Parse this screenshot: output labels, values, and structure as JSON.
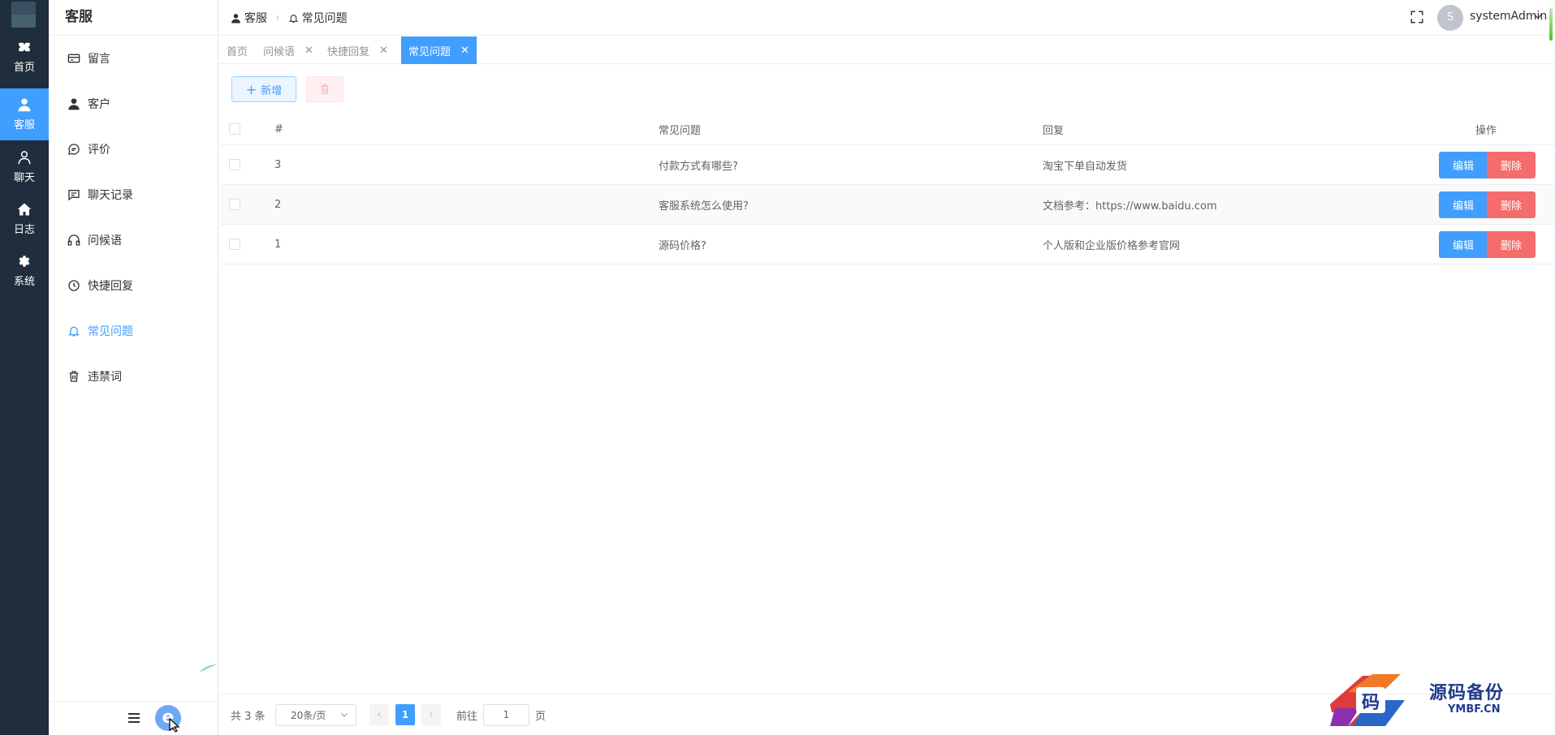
{
  "rail": {
    "items": [
      {
        "label": "首页",
        "icon": "home-ticket-icon"
      },
      {
        "label": "客服",
        "icon": "person-icon",
        "active": true
      },
      {
        "label": "聊天",
        "icon": "user-outline-icon"
      },
      {
        "label": "日志",
        "icon": "house-icon"
      },
      {
        "label": "系统",
        "icon": "gear-icon"
      }
    ]
  },
  "sidebar": {
    "title": "客服",
    "items": [
      {
        "label": "留言",
        "icon": "card-icon"
      },
      {
        "label": "客户",
        "icon": "person-icon"
      },
      {
        "label": "评价",
        "icon": "chat-circle-icon"
      },
      {
        "label": "聊天记录",
        "icon": "message-icon"
      },
      {
        "label": "问候语",
        "icon": "headset-icon"
      },
      {
        "label": "快捷回复",
        "icon": "clock-icon"
      },
      {
        "label": "常见问题",
        "icon": "bell-icon",
        "active": true
      },
      {
        "label": "违禁词",
        "icon": "trash-icon"
      }
    ],
    "footer_logo": "e"
  },
  "topbar": {
    "breadcrumb": [
      "客服",
      "常见问题"
    ],
    "avatar_letter": "S",
    "username": "systemAdmin"
  },
  "tags": [
    {
      "label": "首页",
      "closable": false
    },
    {
      "label": "问候语",
      "closable": true
    },
    {
      "label": "快捷回复",
      "closable": true
    },
    {
      "label": "常见问题",
      "closable": true,
      "active": true
    }
  ],
  "toolbar": {
    "add_label": "新增"
  },
  "table": {
    "headers": {
      "num": "#",
      "question": "常见问题",
      "answer": "回复",
      "ops": "操作"
    },
    "rows": [
      {
        "num": "3",
        "question": "付款方式有哪些?",
        "answer": "淘宝下单自动发货"
      },
      {
        "num": "2",
        "question": "客服系统怎么使用?",
        "answer": "文档参考：https://www.baidu.com"
      },
      {
        "num": "1",
        "question": "源码价格?",
        "answer": "个人版和企业版价格参考官网"
      }
    ],
    "edit_label": "编辑",
    "delete_label": "删除"
  },
  "pagination": {
    "total": "共 3 条",
    "page_size": "20条/页",
    "current": "1",
    "goto_prefix": "前往",
    "goto_value": "1",
    "goto_suffix": "页"
  },
  "watermark": {
    "title": "源码备份",
    "subtitle": "YMBF.CN"
  },
  "colors": {
    "primary": "#409eff",
    "danger": "#f56c6c",
    "rail_bg": "#1f2d3d"
  }
}
